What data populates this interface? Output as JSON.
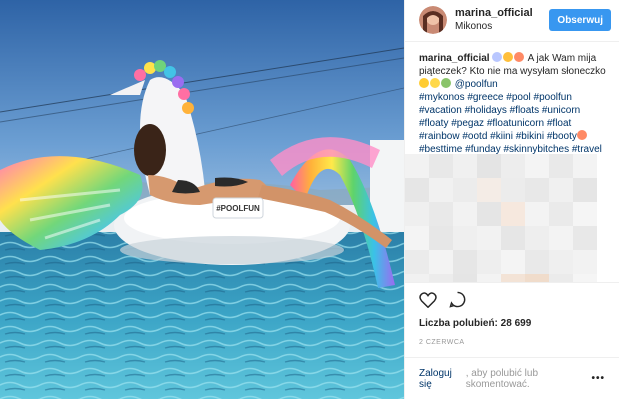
{
  "post": {
    "username": "marina_official",
    "location": "Mikonos",
    "follow_label": "Obserwuj",
    "caption_text": "A jak Wam mija piąteczek? Kto nie ma wysyłam słoneczko",
    "mention": "@poolfun",
    "hashtags": "#mykonos #greece #pool #poolfun #vacation #holidays #floats #unicorn #floaty #pegaz #floatunicorn #float #rainbow #ootd #kiini #bikini #booty",
    "hashtags_tail": "#besttime #funday #skinnybitches #travel #adventure",
    "likes_label": "Liczba polubień:",
    "likes_count": "28 699",
    "date": "2 czerwca",
    "login_link": "Zaloguj się",
    "login_text": ", aby polubić lub skomentować.",
    "float_text": "#POOLFUN"
  },
  "icons": {
    "like": "heart-icon",
    "comment": "comment-icon",
    "more": "more-dots-icon"
  },
  "colors": {
    "follow_button": "#3897f0",
    "link": "#003569",
    "muted": "#999999"
  }
}
